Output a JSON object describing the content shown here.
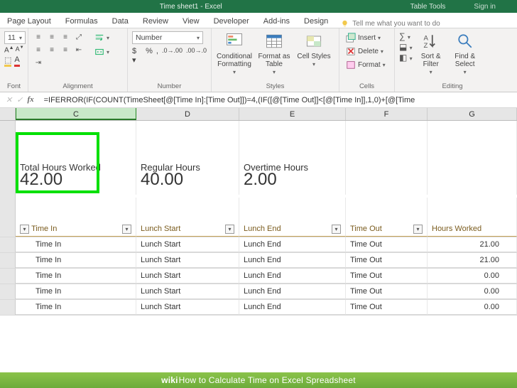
{
  "titlebar": {
    "title": "Time sheet1 - Excel",
    "table_tools": "Table Tools",
    "signin": "Sign in"
  },
  "ribbon_tabs": {
    "page_layout": "Page Layout",
    "formulas": "Formulas",
    "data": "Data",
    "review": "Review",
    "view": "View",
    "developer": "Developer",
    "addins": "Add-ins",
    "design": "Design",
    "tell_me": "Tell me what you want to do"
  },
  "ribbon": {
    "font_size": "11",
    "number_format": "Number",
    "groups": {
      "font": "Font",
      "alignment": "Alignment",
      "number": "Number",
      "styles": "Styles",
      "cells": "Cells",
      "editing": "Editing"
    },
    "styles_btns": {
      "cond_fmt": "Conditional Formatting",
      "fmt_table": "Format as Table",
      "cell_styles": "Cell Styles"
    },
    "cells_btns": {
      "insert": "Insert",
      "delete": "Delete",
      "format": "Format"
    },
    "editing_btns": {
      "sort_filter": "Sort & Filter",
      "find_select": "Find & Select"
    }
  },
  "formula_bar": {
    "fx": "fx",
    "formula": "=IFERROR(IF(COUNT(TimeSheet[@[Time In]:[Time Out]])=4,(IF([@[Time Out]]<[@[Time In]],1,0)+[@[Time"
  },
  "columns": [
    "C",
    "D",
    "E",
    "F",
    "G"
  ],
  "summary": {
    "labels": {
      "total": "Total Hours Worked",
      "regular": "Regular Hours",
      "overtime": "Overtime Hours"
    },
    "values": {
      "total": "42.00",
      "regular": "40.00",
      "overtime": "2.00"
    }
  },
  "table": {
    "headers": [
      "Time In",
      "Lunch Start",
      "Lunch End",
      "Time Out",
      "Hours Worked"
    ],
    "rows": [
      {
        "time_in": "Time In",
        "lunch_start": "Lunch Start",
        "lunch_end": "Lunch End",
        "time_out": "Time Out",
        "hours": "21.00"
      },
      {
        "time_in": "Time In",
        "lunch_start": "Lunch Start",
        "lunch_end": "Lunch End",
        "time_out": "Time Out",
        "hours": "21.00"
      },
      {
        "time_in": "Time In",
        "lunch_start": "Lunch Start",
        "lunch_end": "Lunch End",
        "time_out": "Time Out",
        "hours": "0.00"
      },
      {
        "time_in": "Time In",
        "lunch_start": "Lunch Start",
        "lunch_end": "Lunch End",
        "time_out": "Time Out",
        "hours": "0.00"
      },
      {
        "time_in": "Time In",
        "lunch_start": "Lunch Start",
        "lunch_end": "Lunch End",
        "time_out": "Time Out",
        "hours": "0.00"
      }
    ]
  },
  "wikihow": {
    "prefix": "wiki",
    "suffix": "How to Calculate Time on Excel Spreadsheet"
  }
}
